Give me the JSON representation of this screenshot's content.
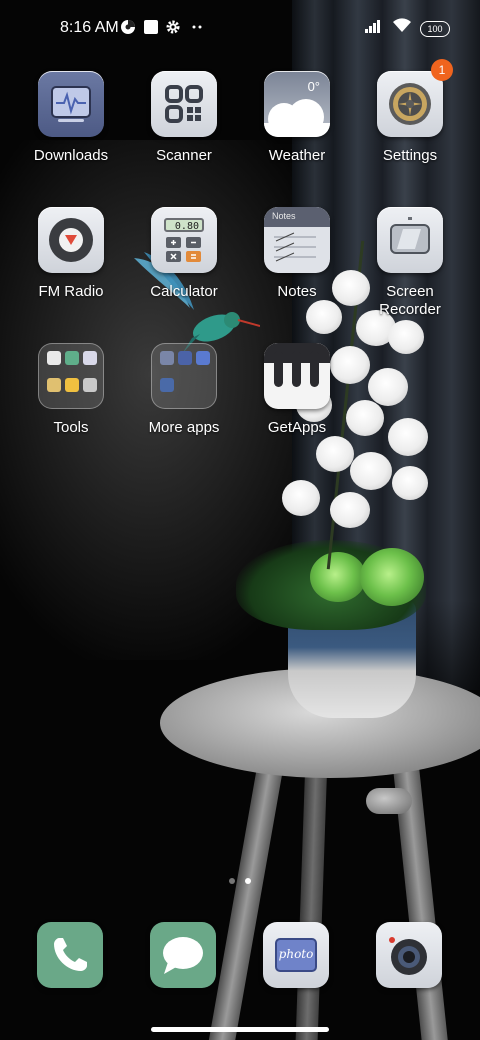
{
  "status_bar": {
    "time": "8:16 AM",
    "battery": "100",
    "icons": [
      "data-saver-icon",
      "square-notification-icon",
      "gear-icon",
      "more-dots-icon",
      "signal-icon",
      "wifi-icon",
      "battery-icon"
    ]
  },
  "apps": [
    {
      "label": "Downloads",
      "icon": "downloads-icon"
    },
    {
      "label": "Scanner",
      "icon": "scanner-icon"
    },
    {
      "label": "Weather",
      "icon": "weather-icon",
      "temperature": "0°"
    },
    {
      "label": "Settings",
      "icon": "settings-gear-icon",
      "badge": "1"
    },
    {
      "label": "FM Radio",
      "icon": "fm-radio-icon"
    },
    {
      "label": "Calculator",
      "icon": "calculator-icon",
      "display": "0.80"
    },
    {
      "label": "Notes",
      "icon": "notes-icon",
      "header": "Notes"
    },
    {
      "label": "Screen\nRecorder",
      "icon": "screen-recorder-icon"
    },
    {
      "label": "Tools",
      "icon": "folder-icon"
    },
    {
      "label": "More apps",
      "icon": "folder-icon"
    },
    {
      "label": "GetApps",
      "icon": "getapps-icon"
    }
  ],
  "pagination": {
    "pages": 2,
    "current": 2
  },
  "dock": [
    {
      "name": "Phone",
      "icon": "phone-icon"
    },
    {
      "name": "Messages",
      "icon": "message-icon"
    },
    {
      "name": "Gallery",
      "icon": "gallery-icon",
      "text": "photo"
    },
    {
      "name": "Camera",
      "icon": "camera-icon"
    }
  ],
  "colors": {
    "badge": "#f0641e",
    "phone": "#6aa888",
    "messages": "#6aa888",
    "tile": "#dde0e6"
  }
}
